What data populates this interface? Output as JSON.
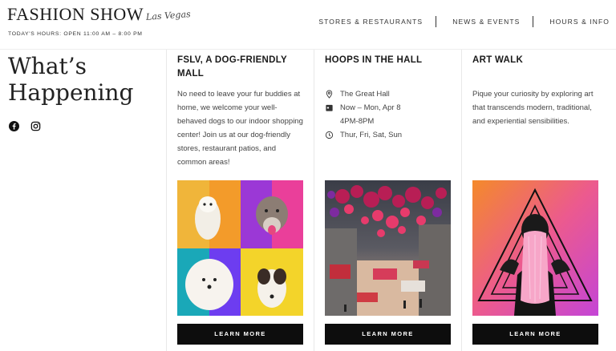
{
  "header": {
    "logo_main": "FASHION SHOW",
    "logo_script": "Las Vegas",
    "hours": "TODAY'S HOURS: OPEN 11:00 AM – 8:00 PM",
    "nav": [
      "STORES & RESTAURANTS",
      "NEWS & EVENTS",
      "HOURS & INFO"
    ]
  },
  "section": {
    "title_line1": "What’s",
    "title_line2": "Happening",
    "social": [
      "facebook-icon",
      "instagram-icon"
    ]
  },
  "cards": [
    {
      "title": "FSLV, A DOG-FRIENDLY MALL",
      "description": "No need to leave your fur buddies at home, we welcome your well-behaved dogs to our indoor shopping center! Join us at our dog-friendly stores, restaurant patios, and common areas!",
      "button": "LEARN MORE"
    },
    {
      "title": "HOOPS IN THE HALL",
      "location": "The Great Hall",
      "dates_line1": "Now – Mon, Apr 8",
      "dates_line2": "4PM-8PM",
      "days": "Thur, Fri, Sat, Sun",
      "button": "LEARN MORE"
    },
    {
      "title": "ART WALK",
      "description": "Pique your curiosity by exploring art that transcends modern, traditional, and experiential sensibilities.",
      "button": "LEARN MORE"
    }
  ]
}
